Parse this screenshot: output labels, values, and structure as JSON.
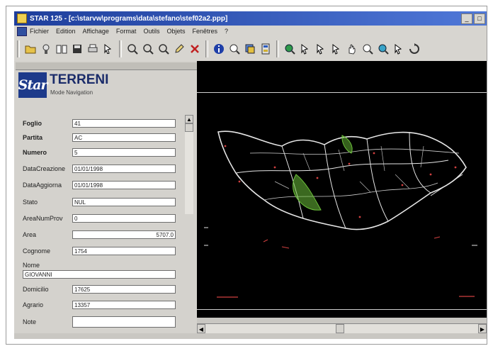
{
  "window": {
    "title": "STAR 125 - [c:\\starvw\\programs\\data\\stefano\\stef02a2.ppp]",
    "controls": [
      "_",
      "□"
    ]
  },
  "menu": [
    "Fichier",
    "Edition",
    "Affichage",
    "Format",
    "Outils",
    "Objets",
    "Fenêtres",
    "?"
  ],
  "panel": {
    "logo_text": "Star",
    "title": "TERRENI",
    "subtitle": "Mode Navigation"
  },
  "fields": [
    {
      "label": "Foglio",
      "value": "41"
    },
    {
      "label": "Partita",
      "value": "AC"
    },
    {
      "label": "Numero",
      "value": "5"
    },
    {
      "label": "DataCreazione",
      "value": "01/01/1998"
    },
    {
      "label": "DataAggiorna",
      "value": "01/01/1998"
    },
    {
      "label": "Stato",
      "value": "NUL"
    },
    {
      "label": "AreaNumProv",
      "value": "0"
    },
    {
      "label": "Area",
      "value": "5707.0"
    },
    {
      "label": "Cognome",
      "value": "1754"
    },
    {
      "label": "Nome",
      "value": "GIOVANNI"
    },
    {
      "label": "Domicilio",
      "value": "17625"
    },
    {
      "label": "Agrario",
      "value": "13357"
    },
    {
      "label": "Note",
      "value": ""
    }
  ],
  "colors": {
    "title_bar": "#1e3e9c",
    "map_background": "#000000",
    "map_lines": "#e6e6e6",
    "parcel_highlight": "#6bbf3a",
    "marker": "#d04040"
  }
}
